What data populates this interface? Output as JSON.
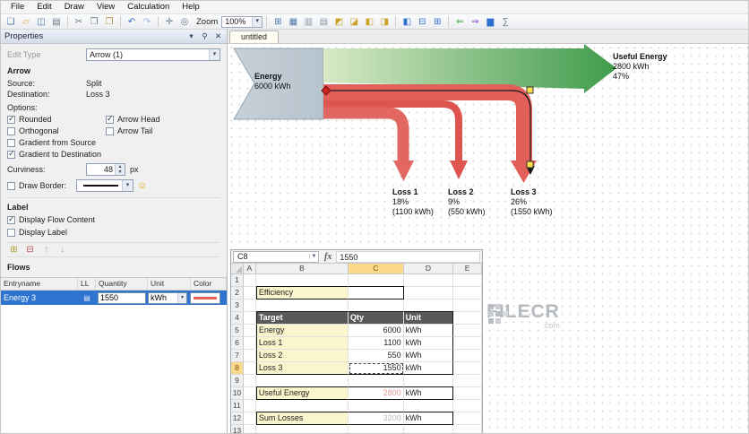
{
  "menu": {
    "items": [
      "File",
      "Edit",
      "Draw",
      "View",
      "Calculation",
      "Help"
    ]
  },
  "toolbar": {
    "items": [
      {
        "type": "button",
        "name": "new-document-icon",
        "glyph": "❏",
        "color": "#4a76a8"
      },
      {
        "type": "button",
        "name": "open-folder-icon",
        "glyph": "▱",
        "color": "#d9a33c"
      },
      {
        "type": "button",
        "name": "save-icon",
        "glyph": "◫",
        "color": "#4a76a8"
      },
      {
        "type": "button",
        "name": "print-icon",
        "glyph": "▤",
        "color": "#667788"
      },
      {
        "type": "sep"
      },
      {
        "type": "button",
        "name": "cut-icon",
        "glyph": "✂",
        "color": "#667788"
      },
      {
        "type": "button",
        "name": "copy-icon",
        "glyph": "❐",
        "color": "#667788"
      },
      {
        "type": "button",
        "name": "paste-icon",
        "glyph": "❒",
        "color": "#b08d3e"
      },
      {
        "type": "sep"
      },
      {
        "type": "button",
        "name": "undo-icon",
        "glyph": "↶",
        "color": "#2f6fd0"
      },
      {
        "type": "button",
        "name": "redo-icon",
        "glyph": "↷",
        "color": "#9db6e8"
      },
      {
        "type": "sep"
      },
      {
        "type": "button",
        "name": "pan-tool-icon",
        "glyph": "✛",
        "color": "#667788"
      },
      {
        "type": "button",
        "name": "zoom-tool-icon",
        "glyph": "◎",
        "color": "#667788"
      },
      {
        "type": "label",
        "name": "zoom-label",
        "text": "Zoom"
      },
      {
        "type": "combo",
        "name": "zoom-select",
        "text": "100%"
      },
      {
        "type": "sep"
      },
      {
        "type": "button",
        "name": "show-grid-icon",
        "glyph": "⊞",
        "color": "#4a76a8"
      },
      {
        "type": "button",
        "name": "snap-to-grid-icon",
        "glyph": "▦",
        "color": "#4a76a8"
      },
      {
        "type": "button",
        "name": "guides-icon",
        "glyph": "▥",
        "color": "#8899aa"
      },
      {
        "type": "button",
        "name": "rulers-icon",
        "glyph": "▤",
        "color": "#8899aa"
      },
      {
        "type": "button",
        "name": "bring-to-front-icon",
        "glyph": "◩",
        "color": "#c9a227"
      },
      {
        "type": "button",
        "name": "send-to-back-icon",
        "glyph": "◪",
        "color": "#c9a227"
      },
      {
        "type": "button",
        "name": "bring-forward-icon",
        "glyph": "◧",
        "color": "#c9a227"
      },
      {
        "type": "button",
        "name": "send-backward-icon",
        "glyph": "◨",
        "color": "#c9a227"
      },
      {
        "type": "sep"
      },
      {
        "type": "button",
        "name": "layout-panel-left-icon",
        "glyph": "◧",
        "color": "#2f6fd0"
      },
      {
        "type": "button",
        "name": "layout-panel-bottom-icon",
        "glyph": "⊟",
        "color": "#2f6fd0"
      },
      {
        "type": "button",
        "name": "layout-panel-grid-icon",
        "glyph": "⊞",
        "color": "#2f6fd0"
      },
      {
        "type": "sep"
      },
      {
        "type": "button",
        "name": "flow-direction-left-icon",
        "glyph": "⇐",
        "color": "#3aa23a"
      },
      {
        "type": "button",
        "name": "flow-direction-right-icon",
        "glyph": "⇒",
        "color": "#8a4ad8"
      },
      {
        "type": "button",
        "name": "chart-icon",
        "glyph": "▆",
        "color": "#2f6fd0"
      },
      {
        "type": "button",
        "name": "calculation-icon",
        "glyph": "∑",
        "color": "#667788"
      }
    ]
  },
  "tabs": [
    {
      "label": "untitled"
    }
  ],
  "properties_panel": {
    "title": "Properties",
    "title_icons": [
      {
        "name": "chevron-down-icon",
        "glyph": "▾"
      },
      {
        "name": "pin-icon",
        "glyph": "⚲"
      },
      {
        "name": "close-icon",
        "glyph": "✕"
      }
    ],
    "edit_type_label": "Edit Type",
    "edit_type_value": "Arrow (1)",
    "arrow": {
      "title": "Arrow",
      "source_label": "Source:",
      "source_value": "Split",
      "destination_label": "Destination:",
      "destination_value": "Loss 3",
      "options_label": "Options:",
      "option_checkboxes": [
        {
          "label": "Rounded",
          "checked": true
        },
        {
          "label": "Arrow Head",
          "checked": true
        },
        {
          "label": "Orthogonal",
          "checked": false
        },
        {
          "label": "Arrow Tail",
          "checked": false
        },
        {
          "label": "Gradient from Source",
          "checked": false
        },
        {
          "label": "Gradient to Destination",
          "checked": true
        }
      ],
      "curviness_label": "Curviness:",
      "curviness_value": "48",
      "curviness_unit": "px",
      "draw_border_label": "Draw Border:"
    },
    "label_group": {
      "title": "Label",
      "checkboxes": [
        {
          "label": "Display Flow Content",
          "checked": true
        },
        {
          "label": "Display Label",
          "checked": false
        }
      ]
    },
    "flow_tools": [
      {
        "name": "add-flow-icon",
        "glyph": "⊞",
        "color": "#b59a3a"
      },
      {
        "name": "delete-flow-icon",
        "glyph": "⊟",
        "color": "#b55555"
      },
      {
        "name": "move-up-icon",
        "glyph": "↑",
        "color": "#ababab"
      },
      {
        "name": "move-down-icon",
        "glyph": "↓",
        "color": "#ababab"
      }
    ],
    "flows": {
      "title": "Flows",
      "columns": [
        "Entryname",
        "LL",
        "Quantity",
        "Unit",
        "Color"
      ],
      "rows": [
        {
          "entryname": "Energy 3",
          "quantity": "1550",
          "unit": "kWh"
        }
      ]
    }
  },
  "sankey": {
    "source": {
      "name": "Energy",
      "value": "6000 kWh"
    },
    "useful": {
      "name": "Useful Energy",
      "value": "2800 kWh",
      "percent": "47%"
    },
    "losses": [
      {
        "name": "Loss 1",
        "percent": "18%",
        "value": "(1100 kWh)"
      },
      {
        "name": "Loss 2",
        "percent": "9%",
        "value": "(550 kWh)"
      },
      {
        "name": "Loss 3",
        "percent": "26%",
        "value": "(1550 kWh)"
      }
    ],
    "colors": {
      "source": "#b7c3cd",
      "source_edge": "#93a5b3",
      "useful_start": "#d8e9c6",
      "useful_end": "#3f9b4c",
      "loss": "#e25f5a",
      "selection_handle": "#ffe24a"
    }
  },
  "spreadsheet": {
    "name_box": "C8",
    "fx_label": "fx",
    "formula_value": "1550",
    "columns": [
      "A",
      "B",
      "C",
      "D",
      "E"
    ],
    "row_count": 13,
    "selected_col": "C",
    "selected_row": 8,
    "cells": {
      "B2": {
        "v": "Efficiency",
        "c": "lbl bt bb bl"
      },
      "C2": {
        "v": "",
        "c": "bt bb br"
      },
      "B4": {
        "v": "Target",
        "c": "hdr bt bl"
      },
      "C4": {
        "v": "Qty",
        "c": "hdr bt"
      },
      "D4": {
        "v": "Unit",
        "c": "hdr bt br"
      },
      "B5": {
        "v": "Energy",
        "c": "lbl bl"
      },
      "C5": {
        "v": "6000",
        "c": "num"
      },
      "D5": {
        "v": "kWh",
        "c": "br"
      },
      "B6": {
        "v": "Loss 1",
        "c": "lbl bl"
      },
      "C6": {
        "v": "1100",
        "c": "num"
      },
      "D6": {
        "v": "kWh",
        "c": "br"
      },
      "B7": {
        "v": "Loss 2",
        "c": "lbl bl"
      },
      "C7": {
        "v": "550",
        "c": "num"
      },
      "D7": {
        "v": "kWh",
        "c": "br"
      },
      "B8": {
        "v": "Loss 3",
        "c": "lbl bl bb"
      },
      "C8": {
        "v": "1550",
        "c": "num bb sel"
      },
      "D8": {
        "v": "kWh",
        "c": "br bb"
      },
      "B10": {
        "v": "Useful Energy",
        "c": "lbl bt bb bl"
      },
      "C10": {
        "v": "2800",
        "c": "numpink bt bb"
      },
      "D10": {
        "v": "kWh",
        "c": "bt bb br"
      },
      "B12": {
        "v": "Sum Losses",
        "c": "lbl bt bb bl"
      },
      "C12": {
        "v": "3200",
        "c": "numgray bt bb"
      },
      "D12": {
        "v": "kWh",
        "c": "bt bb br"
      }
    }
  },
  "watermark": {
    "text": "FILECR",
    "suffix": ".com"
  }
}
